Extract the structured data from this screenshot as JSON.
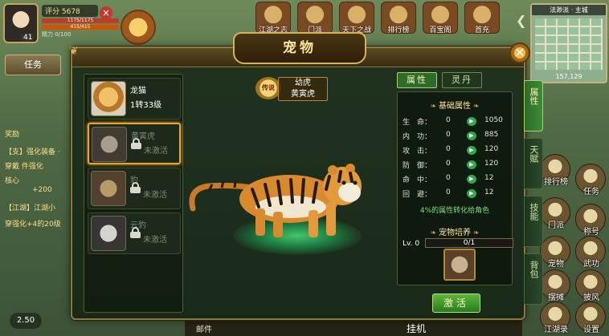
{
  "player": {
    "level": "41",
    "rating": "评分 5678",
    "hp": "1175/1175",
    "mp": "415/415",
    "stamina": "精力 0/100"
  },
  "top_icons": [
    "江湖之志",
    "门派",
    "天下之战",
    "排行榜",
    "百宝阁",
    "首充"
  ],
  "minimap": {
    "title": "法渺派 · 主城",
    "coords": "157,129"
  },
  "left_hud": {
    "task_label": "任务",
    "lines": [
      "奖励",
      "【支】强化装备 ·",
      "穿戴   件强化",
      "核心",
      "+200",
      "【江湖】江湖小",
      "穿强化+4的20级"
    ]
  },
  "bottom": {
    "counter": "2.50",
    "mail": "邮件",
    "afk": "挂机"
  },
  "right_hud": [
    "排行榜",
    "任务",
    "门派",
    "称号",
    "宠物",
    "武功",
    "摆摊",
    "披风",
    "江湖录",
    "设置"
  ],
  "dialog": {
    "title": "宠物",
    "close_label": "✕",
    "pets": [
      {
        "name": "龙猫",
        "sub": "1转33级",
        "locked": false,
        "thumb": "cat"
      },
      {
        "name": "黄寅虎",
        "sub": "未激活",
        "locked": true,
        "thumb": "tiger1"
      },
      {
        "name": "豹",
        "sub": "未激活",
        "locked": true,
        "thumb": "tiger2"
      },
      {
        "name": "云豹",
        "sub": "未激活",
        "locked": true,
        "thumb": "tiger3"
      }
    ],
    "selected_pet": {
      "rarity": "传说",
      "stage": "幼虎",
      "name": "黄寅虎"
    },
    "tabs": [
      "属性",
      "灵丹"
    ],
    "active_tab": 0,
    "side_tabs": [
      "属性",
      "天赋",
      "技能",
      "背包"
    ],
    "active_side_tab": 0,
    "base_attributes_title": "基础属性",
    "attributes": [
      {
        "name": "生　命：",
        "value": "0",
        "next": "1050"
      },
      {
        "name": "内　功：",
        "value": "0",
        "next": "885"
      },
      {
        "name": "攻　击：",
        "value": "0",
        "next": "120"
      },
      {
        "name": "防　御：",
        "value": "0",
        "next": "120"
      },
      {
        "name": "命　中：",
        "value": "0",
        "next": "12"
      },
      {
        "name": "回　避：",
        "value": "0",
        "next": "12"
      }
    ],
    "arrow_glyph": "▶",
    "conversion_note": "4%的属性转化给角色",
    "cultivation_title": "宠物培养",
    "level_label": "Lv. 0",
    "exp": "0/1",
    "activate_label": "激活"
  },
  "colors": {
    "dialog_bg": "#1a2a19",
    "gold_border": "#8a7a3e",
    "title_text": "#ffe39a",
    "accent_green": "#2f6b2a",
    "selected_outline": "#f0a22a"
  }
}
